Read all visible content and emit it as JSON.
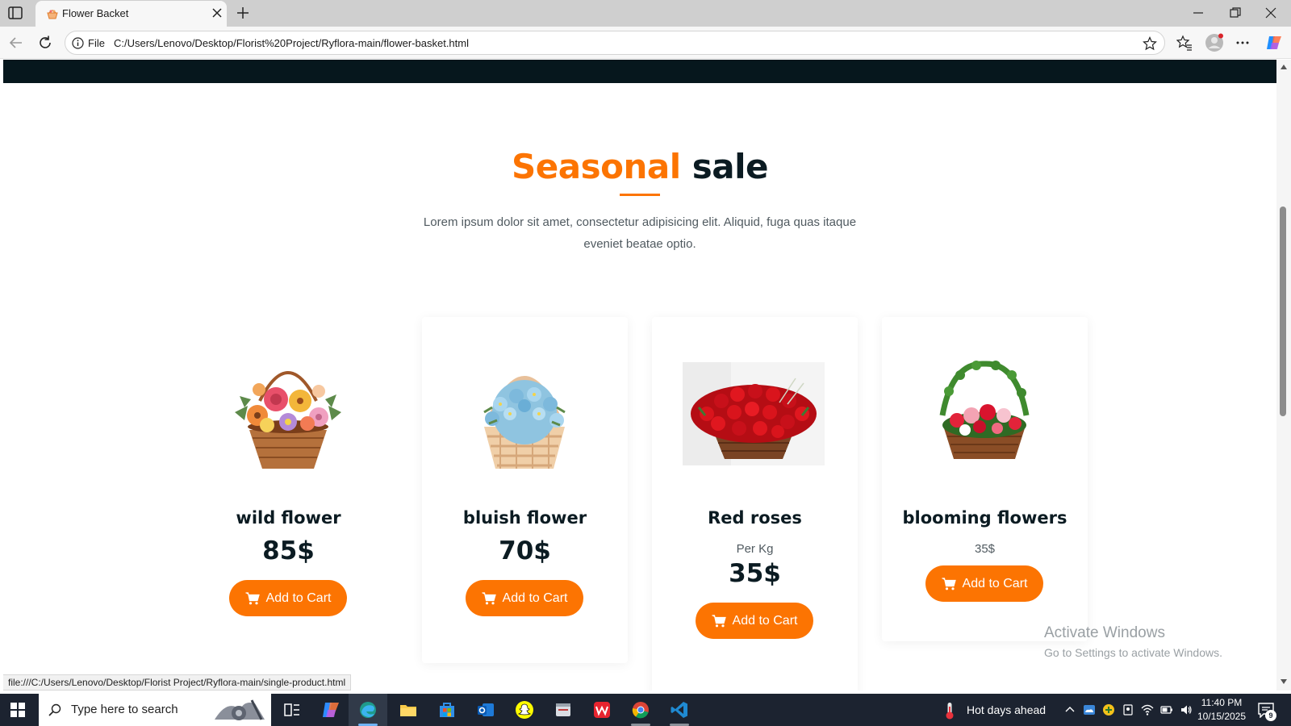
{
  "browser": {
    "tab_title": "Flower Backet",
    "url_scheme": "File",
    "url": "C:/Users/Lenovo/Desktop/Florist%20Project/Ryflora-main/flower-basket.html",
    "status_url": "file:///C:/Users/Lenovo/Desktop/Florist Project/Ryflora-main/single-product.html"
  },
  "section": {
    "title_accent": "Seasonal",
    "title_rest": "sale",
    "description": "Lorem ipsum dolor sit amet, consectetur adipisicing elit. Aliquid, fuga quas itaque eveniet beatae optio."
  },
  "products": [
    {
      "name": "wild flower",
      "unit": "",
      "price": "85$",
      "button_label": "Add to Cart"
    },
    {
      "name": "bluish flower",
      "unit": "",
      "price": "70$",
      "button_label": "Add to Cart"
    },
    {
      "name": "Red roses",
      "unit": "Per Kg",
      "price": "35$",
      "button_label": "Add to Cart"
    },
    {
      "name": "blooming flowers",
      "unit": "35$",
      "price": "",
      "button_label": "Add to Cart"
    }
  ],
  "watermark": {
    "title": "Activate Windows",
    "subtitle": "Go to Settings to activate Windows."
  },
  "taskbar": {
    "search_placeholder": "Type here to search",
    "weather": "Hot days ahead",
    "time": "11:40 PM",
    "date": "10/15/2025",
    "notification_count": "9"
  },
  "colors": {
    "accent": "#fc7402",
    "dark": "#0b1b22",
    "header_strip": "#06171d"
  }
}
